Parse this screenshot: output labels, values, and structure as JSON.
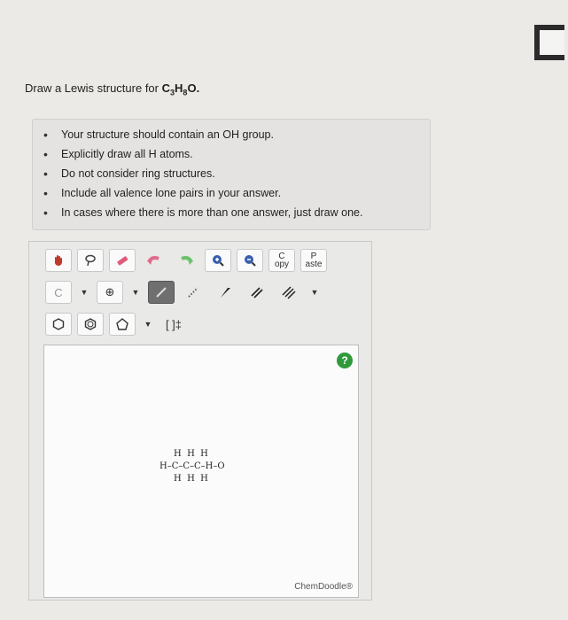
{
  "question": {
    "prefix": "Draw a Lewis structure for",
    "formula_parts": [
      "C",
      "3",
      "H",
      "8",
      "O",
      "."
    ]
  },
  "instructions": [
    "Your structure should contain an OH group.",
    "Explicitly draw all H atoms.",
    "Do not consider ring structures.",
    "Include all valence lone pairs in your answer.",
    "In cases where there is more than one answer, just draw one."
  ],
  "toolbar": {
    "copy_label": "C\nopy",
    "paste_label": "P\naste",
    "element_label": "C",
    "charge_symbol": "⊕",
    "bracket_label": "[ ]‡"
  },
  "molecule": {
    "top_row": "H  H  H",
    "middle_row": "H–C–C–C–H–O",
    "bottom_row": "H  H  H"
  },
  "help_label": "?",
  "brand": "ChemDoodle®",
  "colors": {
    "accent_green": "#2f9a3a"
  }
}
